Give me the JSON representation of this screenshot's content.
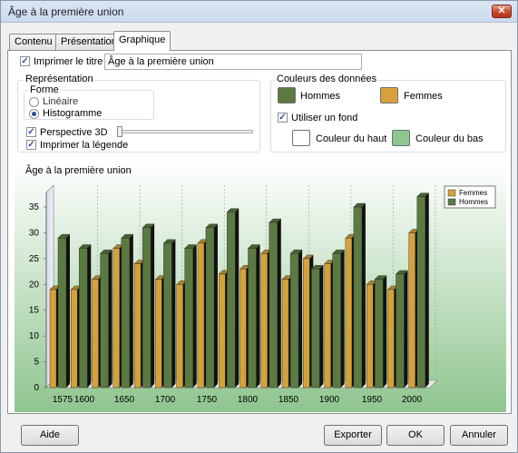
{
  "window": {
    "title": "Âge à la première union",
    "close_glyph": "✕"
  },
  "tabs": [
    {
      "label": "Contenu",
      "active": false
    },
    {
      "label": "Présentation",
      "active": false
    },
    {
      "label": "Graphique",
      "active": true
    }
  ],
  "print_title": {
    "label": "Imprimer le titre",
    "checked": true,
    "value": "Âge à la première union"
  },
  "representation": {
    "group_label": "Représentation",
    "forme_label": "Forme",
    "options": [
      {
        "label": "Linéaire",
        "selected": false
      },
      {
        "label": "Histogramme",
        "selected": true
      }
    ],
    "perspective": {
      "label": "Perspective 3D",
      "checked": true,
      "level": 0
    },
    "print_legend": {
      "label": "Imprimer la légende",
      "checked": true
    }
  },
  "colors": {
    "group_label": "Couleurs des données",
    "hommes": {
      "label": "Hommes",
      "color": "#5b7a42"
    },
    "femmes": {
      "label": "Femmes",
      "color": "#d6a13a"
    },
    "use_background": {
      "label": "Utiliser un fond",
      "checked": true
    },
    "top": {
      "label": "Couleur du haut",
      "color": "#ffffff"
    },
    "bottom": {
      "label": "Couleur du bas",
      "color": "#8fc58f"
    }
  },
  "buttons": {
    "help": "Aide",
    "export": "Exporter",
    "ok": "OK",
    "cancel": "Annuler"
  },
  "chart_data": {
    "type": "bar",
    "title": "Âge à la première union",
    "x_tick_labels": [
      "1575",
      "1600",
      "1650",
      "1700",
      "1750",
      "1800",
      "1850",
      "1900",
      "1950",
      "2000"
    ],
    "y_ticks": [
      0,
      5,
      10,
      15,
      20,
      25,
      30,
      35
    ],
    "ylim": [
      0,
      38
    ],
    "legend_position": "top-right",
    "series": [
      {
        "name": "Femmes",
        "color": "#d6a13a",
        "values": [
          19,
          19,
          21,
          27,
          24,
          21,
          20,
          28,
          22,
          23,
          26,
          21,
          25,
          24,
          29,
          20,
          19,
          30
        ]
      },
      {
        "name": "Hommes",
        "color": "#5b7a42",
        "values": [
          29,
          27,
          26,
          29,
          31,
          28,
          27,
          31,
          34,
          27,
          32,
          26,
          23,
          26,
          35,
          21,
          22,
          37
        ]
      }
    ]
  }
}
